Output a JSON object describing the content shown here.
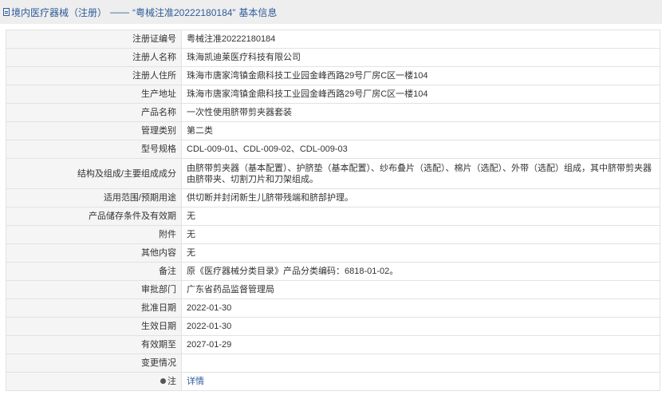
{
  "header": {
    "category": "境内医疗器械（注册）",
    "separator": "——",
    "record_title": "“粤械注准20222180184”",
    "suffix": "基本信息",
    "icon": "document-icon"
  },
  "rows": [
    {
      "label": "注册证编号",
      "value": "粤械注准20222180184"
    },
    {
      "label": "注册人名称",
      "value": "珠海凯迪莱医疗科技有限公司"
    },
    {
      "label": "注册人住所",
      "value": "珠海市唐家湾镇金鼎科技工业园金峰西路29号厂房C区一楼104"
    },
    {
      "label": "生产地址",
      "value": "珠海市唐家湾镇金鼎科技工业园金峰西路29号厂房C区一楼104"
    },
    {
      "label": "产品名称",
      "value": "一次性使用脐带剪夹器套装"
    },
    {
      "label": "管理类别",
      "value": "第二类"
    },
    {
      "label": "型号规格",
      "value": "CDL-009-01、CDL-009-02、CDL-009-03"
    },
    {
      "label": "结构及组成/主要组成成分",
      "value": "由脐带剪夹器（基本配置）、护脐垫（基本配置）、纱布叠片（选配）、棉片（选配）、外带（选配）组成，其中脐带剪夹器由脐带夹、切割刀片和刀架组成。"
    },
    {
      "label": "适用范围/预期用途",
      "value": "供切断并封闭新生儿脐带残端和脐部护理。"
    },
    {
      "label": "产品储存条件及有效期",
      "value": "无"
    },
    {
      "label": "附件",
      "value": "无"
    },
    {
      "label": "其他内容",
      "value": "无"
    },
    {
      "label": "备注",
      "value": "原《医疗器械分类目录》产品分类编码：6818-01-02。"
    },
    {
      "label": "审批部门",
      "value": "广东省药品监督管理局"
    },
    {
      "label": "批准日期",
      "value": "2022-01-30"
    },
    {
      "label": "生效日期",
      "value": "2022-01-30"
    },
    {
      "label": "有效期至",
      "value": "2027-01-29"
    },
    {
      "label": "变更情况",
      "value": ""
    }
  ],
  "footer_row": {
    "label": "注",
    "label_icon": "pin-icon",
    "link_text": "详情"
  },
  "colors": {
    "title_text": "#2e5c99",
    "label_bg": "#f5f5f5",
    "border": "#e2e2e2"
  }
}
